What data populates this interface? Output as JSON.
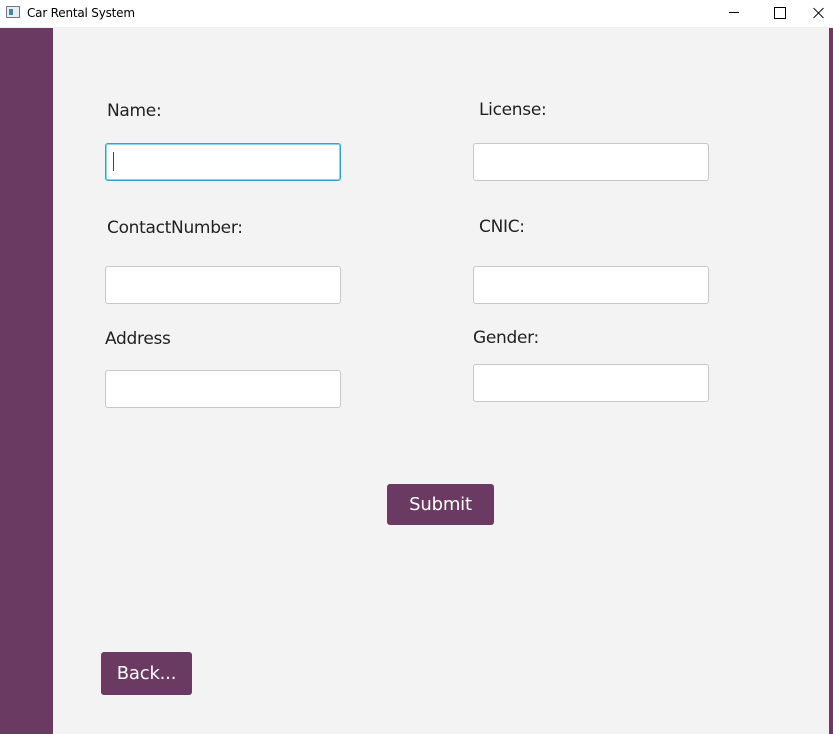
{
  "window": {
    "title": "Car Rental System"
  },
  "form": {
    "name_label": "Name:",
    "name_value": "",
    "license_label": "License:",
    "license_value": "",
    "contact_label": "ContactNumber:",
    "contact_value": "",
    "cnic_label": "CNIC:",
    "cnic_value": "",
    "address_label": "Address",
    "address_value": "",
    "gender_label": "Gender:",
    "gender_value": ""
  },
  "actions": {
    "submit_label": "Submit",
    "back_label": "Back..."
  },
  "colors": {
    "accent": "#6b3a62",
    "background": "#f3f3f3",
    "focus": "#2aa3d8"
  }
}
